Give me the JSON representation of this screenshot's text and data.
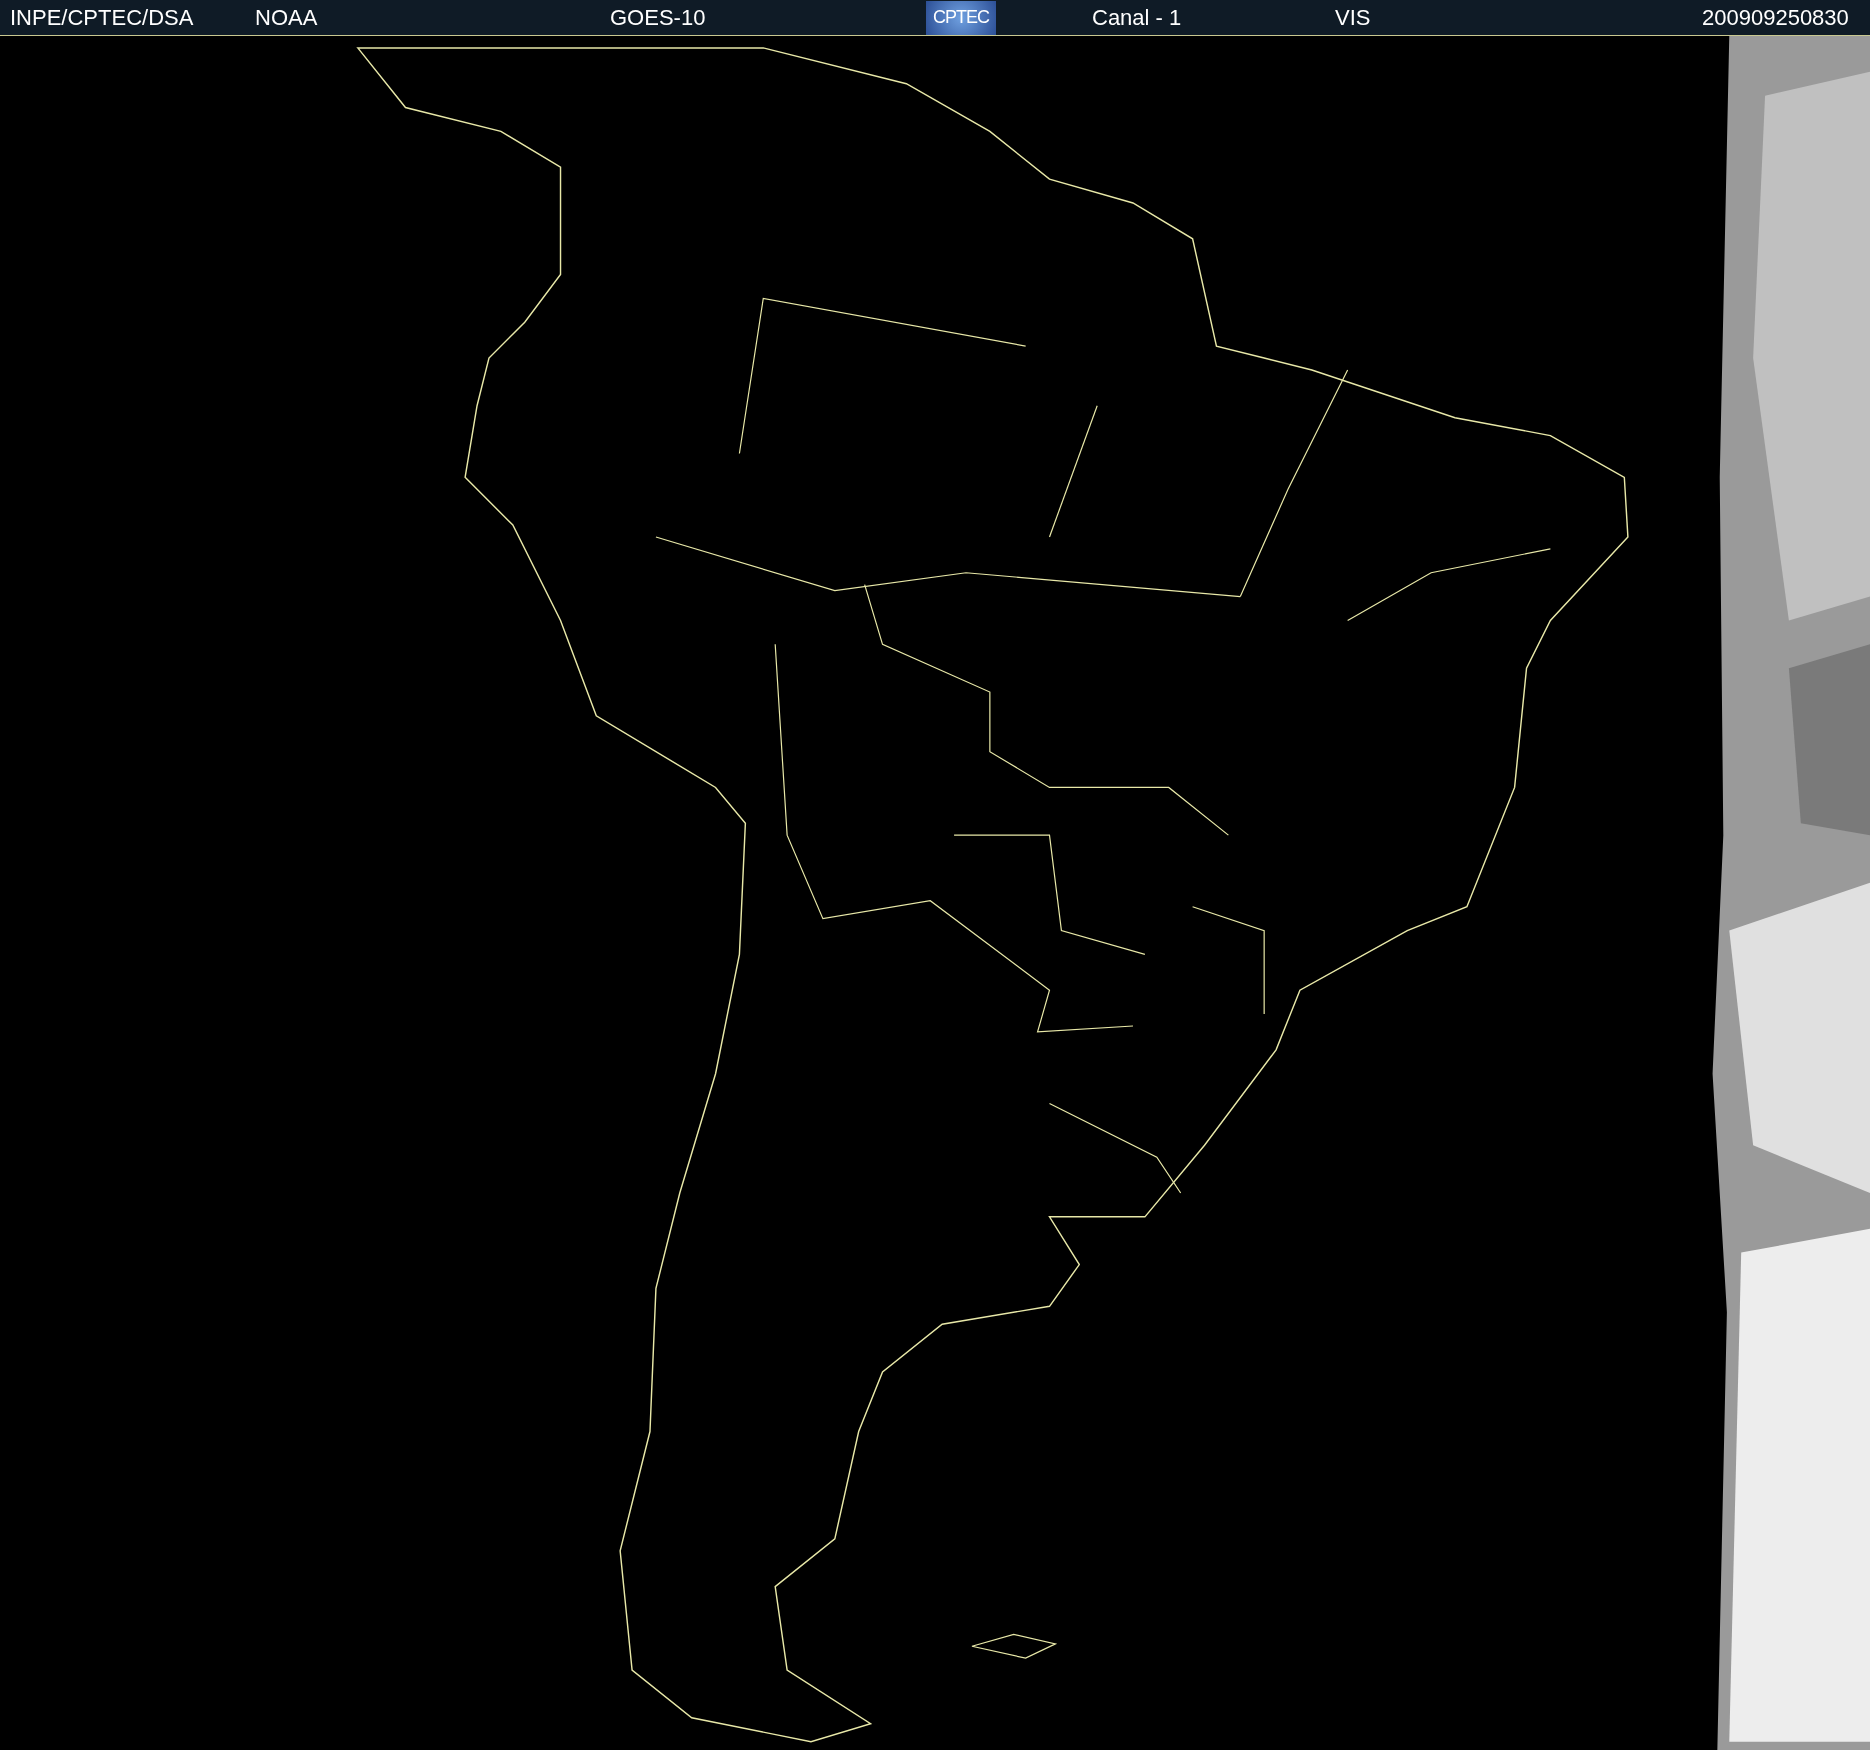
{
  "header": {
    "source": "INPE/CPTEC/DSA",
    "agency": "NOAA",
    "satellite": "GOES-10",
    "logo": "CPTEC",
    "channel": "Canal - 1",
    "band": "VIS",
    "timestamp": "200909250830"
  }
}
